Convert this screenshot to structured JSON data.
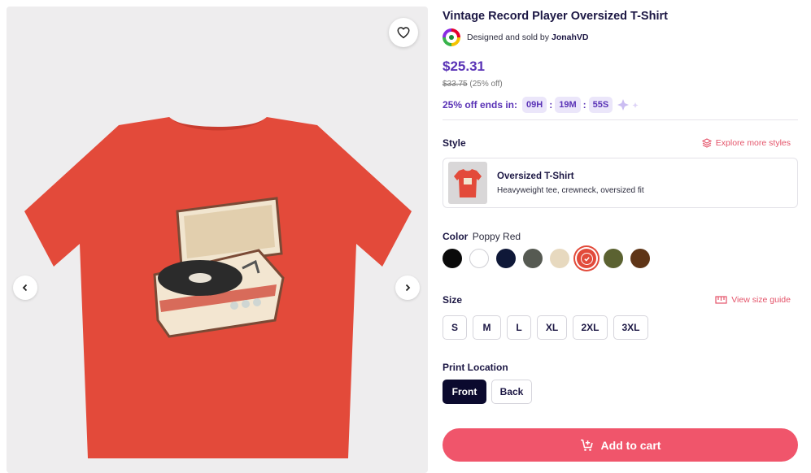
{
  "gallery": {
    "favorite_icon": "heart-icon",
    "prev_icon": "chevron-left-icon",
    "next_icon": "chevron-right-icon",
    "image_color": "#e34a3a"
  },
  "product": {
    "title": "Vintage Record Player Oversized T-Shirt",
    "seller_prefix": "Designed and sold by",
    "seller_name": "JonahVD",
    "price": "$25.31",
    "original_price": "$33.75",
    "discount": "(25% off)",
    "sale_label": "25% off ends in:",
    "timer": {
      "hours": "09H",
      "minutes": "19M",
      "seconds": "55S",
      "separator": ":"
    }
  },
  "style": {
    "label": "Style",
    "explore_label": "Explore more styles",
    "selected_name": "Oversized T-Shirt",
    "selected_desc": "Heavyweight tee, crewneck, oversized fit"
  },
  "color": {
    "label": "Color",
    "selected": "Poppy Red",
    "swatches": [
      {
        "name": "Black",
        "hex": "#0a0a0a"
      },
      {
        "name": "White",
        "hex": "#ffffff"
      },
      {
        "name": "Navy",
        "hex": "#0f1838"
      },
      {
        "name": "Charcoal",
        "hex": "#565a52"
      },
      {
        "name": "Sand",
        "hex": "#e7d9bf"
      },
      {
        "name": "Poppy Red",
        "hex": "#e24a3a"
      },
      {
        "name": "Olive",
        "hex": "#5b6231"
      },
      {
        "name": "Brown",
        "hex": "#5f3517"
      }
    ]
  },
  "size": {
    "label": "Size",
    "guide_label": "View size guide",
    "options": [
      "S",
      "M",
      "L",
      "XL",
      "2XL",
      "3XL"
    ]
  },
  "print_location": {
    "label": "Print Location",
    "options": [
      "Front",
      "Back"
    ],
    "selected": "Front"
  },
  "cart": {
    "label": "Add to cart"
  },
  "colors": {
    "accent": "#5a33b6",
    "cta": "#f0556b",
    "link": "#e4546a",
    "dark": "#0b0a2e"
  }
}
